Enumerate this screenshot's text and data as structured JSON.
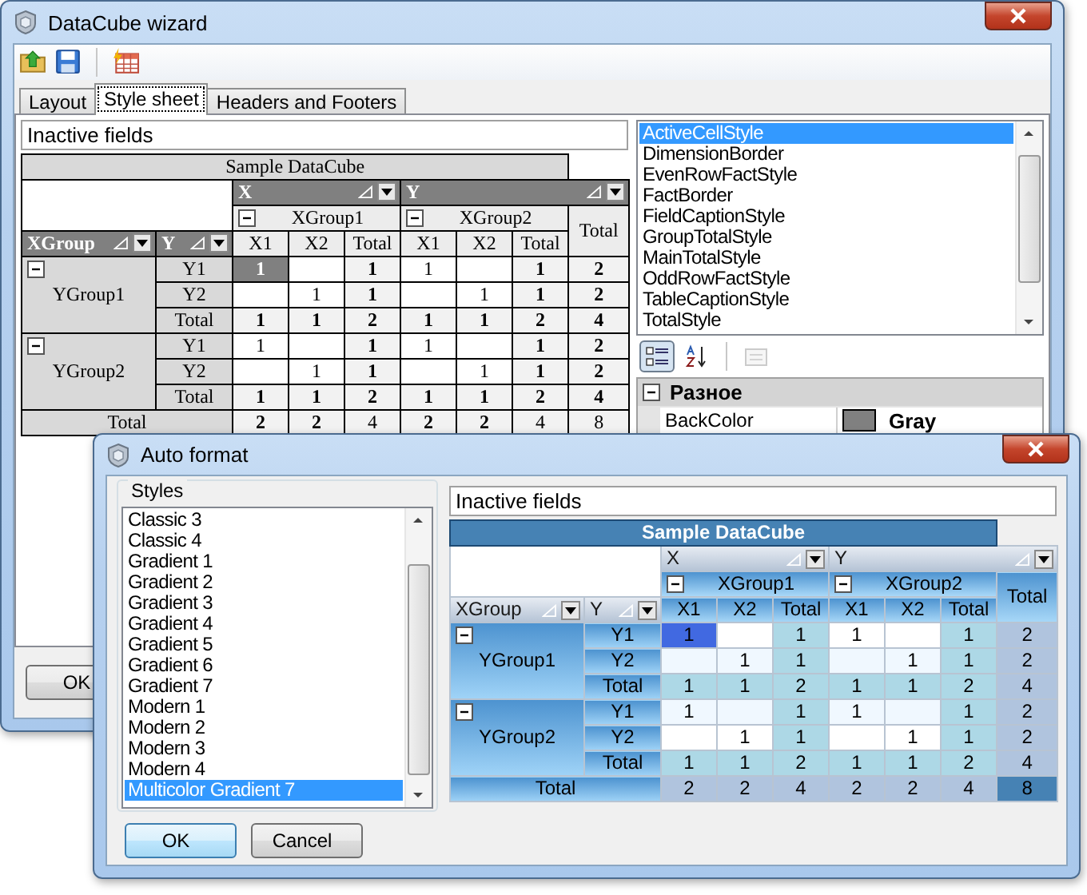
{
  "main_window": {
    "title": "DataCube wizard",
    "toolbar": [
      {
        "kind": "open"
      },
      {
        "kind": "save"
      },
      {
        "kind": "autoformat"
      }
    ],
    "tabs": [
      {
        "label": "Layout",
        "selected": false
      },
      {
        "label": "Style sheet",
        "selected": true
      },
      {
        "label": "Headers and Footers",
        "selected": false
      }
    ],
    "inactive_fields": "Inactive fields",
    "pivot": {
      "kind": "classic",
      "caption": "Sample DataCube",
      "column_fields": [
        "X",
        "Y"
      ],
      "row_fields": [
        "XGroup",
        "Y"
      ],
      "column_groups": [
        {
          "name": "XGroup1",
          "expanded": true,
          "columns": [
            "X1",
            "X2",
            "Total"
          ]
        },
        {
          "name": "XGroup2",
          "expanded": true,
          "columns": [
            "X1",
            "X2",
            "Total"
          ]
        }
      ],
      "grand_total_header": "Total",
      "row_groups": [
        {
          "name": "YGroup1",
          "expanded": true,
          "rows": [
            {
              "label": "Y1",
              "kind": "data",
              "cells": [
                {
                  "text": "1",
                  "selected": true
                },
                {
                  "selected": false
                },
                {
                  "text": "1",
                  "selected": false
                },
                {
                  "text": "1",
                  "selected": false
                },
                {
                  "selected": false
                },
                {
                  "text": "1",
                  "selected": false
                },
                {
                  "text": "2",
                  "selected": false
                }
              ]
            },
            {
              "label": "Y2",
              "kind": "data",
              "cells": [
                {
                  "selected": false
                },
                {
                  "text": "1",
                  "selected": false
                },
                {
                  "text": "1",
                  "selected": false
                },
                {
                  "selected": false
                },
                {
                  "text": "1",
                  "selected": false
                },
                {
                  "text": "1",
                  "selected": false
                },
                {
                  "text": "2",
                  "selected": false
                }
              ]
            },
            {
              "label": "Total",
              "kind": "total",
              "cells": [
                {
                  "text": "1",
                  "selected": false
                },
                {
                  "text": "1",
                  "selected": false
                },
                {
                  "text": "2",
                  "selected": false
                },
                {
                  "text": "1",
                  "selected": false
                },
                {
                  "text": "1",
                  "selected": false
                },
                {
                  "text": "2",
                  "selected": false
                },
                {
                  "text": "4",
                  "selected": false
                }
              ]
            }
          ]
        },
        {
          "name": "YGroup2",
          "expanded": true,
          "rows": [
            {
              "label": "Y1",
              "kind": "data",
              "cells": [
                {
                  "text": "1",
                  "selected": false
                },
                {
                  "selected": false
                },
                {
                  "text": "1",
                  "selected": false
                },
                {
                  "text": "1",
                  "selected": false
                },
                {
                  "selected": false
                },
                {
                  "text": "1",
                  "selected": false
                },
                {
                  "text": "2",
                  "selected": false
                }
              ]
            },
            {
              "label": "Y2",
              "kind": "data",
              "cells": [
                {
                  "selected": false
                },
                {
                  "text": "1",
                  "selected": false
                },
                {
                  "text": "1",
                  "selected": false
                },
                {
                  "selected": false
                },
                {
                  "text": "1",
                  "selected": false
                },
                {
                  "text": "1",
                  "selected": false
                },
                {
                  "text": "2",
                  "selected": false
                }
              ]
            },
            {
              "label": "Total",
              "kind": "total",
              "cells": [
                {
                  "text": "1",
                  "selected": false
                },
                {
                  "text": "1",
                  "selected": false
                },
                {
                  "text": "2",
                  "selected": false
                },
                {
                  "text": "1",
                  "selected": false
                },
                {
                  "text": "1",
                  "selected": false
                },
                {
                  "text": "2",
                  "selected": false
                },
                {
                  "text": "4",
                  "selected": false
                }
              ]
            }
          ]
        }
      ],
      "total_row": {
        "label": "Total",
        "cells": [
          {
            "text": "2",
            "selected": false
          },
          {
            "text": "2",
            "selected": false
          },
          {
            "text": "4",
            "selected": false
          },
          {
            "text": "2",
            "selected": false
          },
          {
            "text": "2",
            "selected": false
          },
          {
            "text": "4",
            "selected": false
          },
          {
            "text": "8",
            "selected": false
          }
        ]
      }
    },
    "style_list": [
      {
        "label": "ActiveCellStyle",
        "selected": true
      },
      {
        "label": "DimensionBorder",
        "selected": false
      },
      {
        "label": "EvenRowFactStyle",
        "selected": false
      },
      {
        "label": "FactBorder",
        "selected": false
      },
      {
        "label": "FieldCaptionStyle",
        "selected": false
      },
      {
        "label": "GroupTotalStyle",
        "selected": false
      },
      {
        "label": "MainTotalStyle",
        "selected": false
      },
      {
        "label": "OddRowFactStyle",
        "selected": false
      },
      {
        "label": "TableCaptionStyle",
        "selected": false
      },
      {
        "label": "TotalStyle",
        "selected": false
      }
    ],
    "property_toolbar": [
      {
        "kind": "categorized",
        "selected": true,
        "disabled": false
      },
      {
        "kind": "alphabetical",
        "selected": false,
        "disabled": false
      },
      {
        "kind": "pages",
        "selected": false,
        "disabled": true
      }
    ],
    "property_grid": {
      "category": "Разное",
      "expanded": true,
      "properties": [
        {
          "name": "BackColor",
          "value": "Gray",
          "color": "#808080"
        }
      ]
    },
    "buttons": [
      "OK"
    ]
  },
  "dialog": {
    "title": "Auto format",
    "styles_label": "Styles",
    "styles": [
      {
        "label": "Classic 3",
        "selected": false
      },
      {
        "label": "Classic 4",
        "selected": false
      },
      {
        "label": "Gradient 1",
        "selected": false
      },
      {
        "label": "Gradient 2",
        "selected": false
      },
      {
        "label": "Gradient 3",
        "selected": false
      },
      {
        "label": "Gradient 4",
        "selected": false
      },
      {
        "label": "Gradient 5",
        "selected": false
      },
      {
        "label": "Gradient 6",
        "selected": false
      },
      {
        "label": "Gradient 7",
        "selected": false
      },
      {
        "label": "Modern 1",
        "selected": false
      },
      {
        "label": "Modern 2",
        "selected": false
      },
      {
        "label": "Modern 3",
        "selected": false
      },
      {
        "label": "Modern 4",
        "selected": false
      },
      {
        "label": "Multicolor Gradient 7",
        "selected": true
      }
    ],
    "inactive_fields": "Inactive fields",
    "pivot": {
      "kind": "multicolor",
      "caption": "Sample DataCube",
      "column_fields": [
        "X",
        "Y"
      ],
      "row_fields": [
        "XGroup",
        "Y"
      ],
      "column_groups": [
        {
          "name": "XGroup1",
          "expanded": true,
          "columns": [
            "X1",
            "X2",
            "Total"
          ]
        },
        {
          "name": "XGroup2",
          "expanded": true,
          "columns": [
            "X1",
            "X2",
            "Total"
          ]
        }
      ],
      "grand_total_header": "Total",
      "row_groups": [
        {
          "name": "YGroup1",
          "expanded": true,
          "rows": [
            {
              "label": "Y1",
              "kind": "data",
              "cells": [
                {
                  "text": "1",
                  "selected": true
                },
                {
                  "selected": false
                },
                {
                  "text": "1",
                  "selected": false
                },
                {
                  "text": "1",
                  "selected": false
                },
                {
                  "selected": false
                },
                {
                  "text": "1",
                  "selected": false
                },
                {
                  "text": "2",
                  "selected": false
                }
              ]
            },
            {
              "label": "Y2",
              "kind": "data",
              "cells": [
                {
                  "selected": false
                },
                {
                  "text": "1",
                  "selected": false
                },
                {
                  "text": "1",
                  "selected": false
                },
                {
                  "selected": false
                },
                {
                  "text": "1",
                  "selected": false
                },
                {
                  "text": "1",
                  "selected": false
                },
                {
                  "text": "2",
                  "selected": false
                }
              ]
            },
            {
              "label": "Total",
              "kind": "total",
              "cells": [
                {
                  "text": "1",
                  "selected": false
                },
                {
                  "text": "1",
                  "selected": false
                },
                {
                  "text": "2",
                  "selected": false
                },
                {
                  "text": "1",
                  "selected": false
                },
                {
                  "text": "1",
                  "selected": false
                },
                {
                  "text": "2",
                  "selected": false
                },
                {
                  "text": "4",
                  "selected": false
                }
              ]
            }
          ]
        },
        {
          "name": "YGroup2",
          "expanded": true,
          "rows": [
            {
              "label": "Y1",
              "kind": "data",
              "cells": [
                {
                  "text": "1",
                  "selected": false
                },
                {
                  "selected": false
                },
                {
                  "text": "1",
                  "selected": false
                },
                {
                  "text": "1",
                  "selected": false
                },
                {
                  "selected": false
                },
                {
                  "text": "1",
                  "selected": false
                },
                {
                  "text": "2",
                  "selected": false
                }
              ]
            },
            {
              "label": "Y2",
              "kind": "data",
              "cells": [
                {
                  "selected": false
                },
                {
                  "text": "1",
                  "selected": false
                },
                {
                  "text": "1",
                  "selected": false
                },
                {
                  "selected": false
                },
                {
                  "text": "1",
                  "selected": false
                },
                {
                  "text": "1",
                  "selected": false
                },
                {
                  "text": "2",
                  "selected": false
                }
              ]
            },
            {
              "label": "Total",
              "kind": "total",
              "cells": [
                {
                  "text": "1",
                  "selected": false
                },
                {
                  "text": "1",
                  "selected": false
                },
                {
                  "text": "2",
                  "selected": false
                },
                {
                  "text": "1",
                  "selected": false
                },
                {
                  "text": "1",
                  "selected": false
                },
                {
                  "text": "2",
                  "selected": false
                },
                {
                  "text": "4",
                  "selected": false
                }
              ]
            }
          ]
        }
      ],
      "total_row": {
        "label": "Total",
        "cells": [
          {
            "text": "2",
            "selected": false
          },
          {
            "text": "2",
            "selected": false
          },
          {
            "text": "4",
            "selected": false
          },
          {
            "text": "2",
            "selected": false
          },
          {
            "text": "2",
            "selected": false
          },
          {
            "text": "4",
            "selected": false
          },
          {
            "text": "8",
            "selected": false
          }
        ]
      }
    },
    "buttons": [
      {
        "label": "OK",
        "default": true
      },
      {
        "label": "Cancel",
        "default": false
      }
    ]
  }
}
